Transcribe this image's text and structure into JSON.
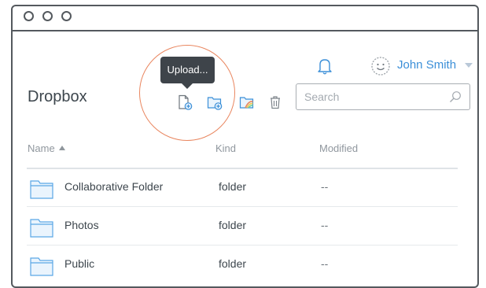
{
  "app": {
    "title": "Dropbox"
  },
  "user": {
    "name": "John Smith"
  },
  "tooltip": {
    "text": "Upload..."
  },
  "search": {
    "placeholder": "Search"
  },
  "columns": {
    "name": "Name",
    "kind": "Kind",
    "modified": "Modified"
  },
  "rows": [
    {
      "name": "Collaborative Folder",
      "kind": "folder",
      "modified": "--"
    },
    {
      "name": "Photos",
      "kind": "folder",
      "modified": "--"
    },
    {
      "name": "Public",
      "kind": "folder",
      "modified": "--"
    }
  ],
  "icons": {
    "toolbar": [
      "upload-file-icon",
      "new-folder-icon",
      "share-folder-icon",
      "trash-icon"
    ],
    "header": [
      "bell-icon",
      "avatar-icon",
      "chevron-down-icon"
    ],
    "search": "search-icon",
    "row": "folder-icon"
  },
  "colors": {
    "accent": "#3b8fd8",
    "highlight": "#e9865f",
    "tooltip_bg": "#3e444a",
    "folder_fill": "#eaf4fd",
    "folder_stroke": "#5aa6e6"
  }
}
